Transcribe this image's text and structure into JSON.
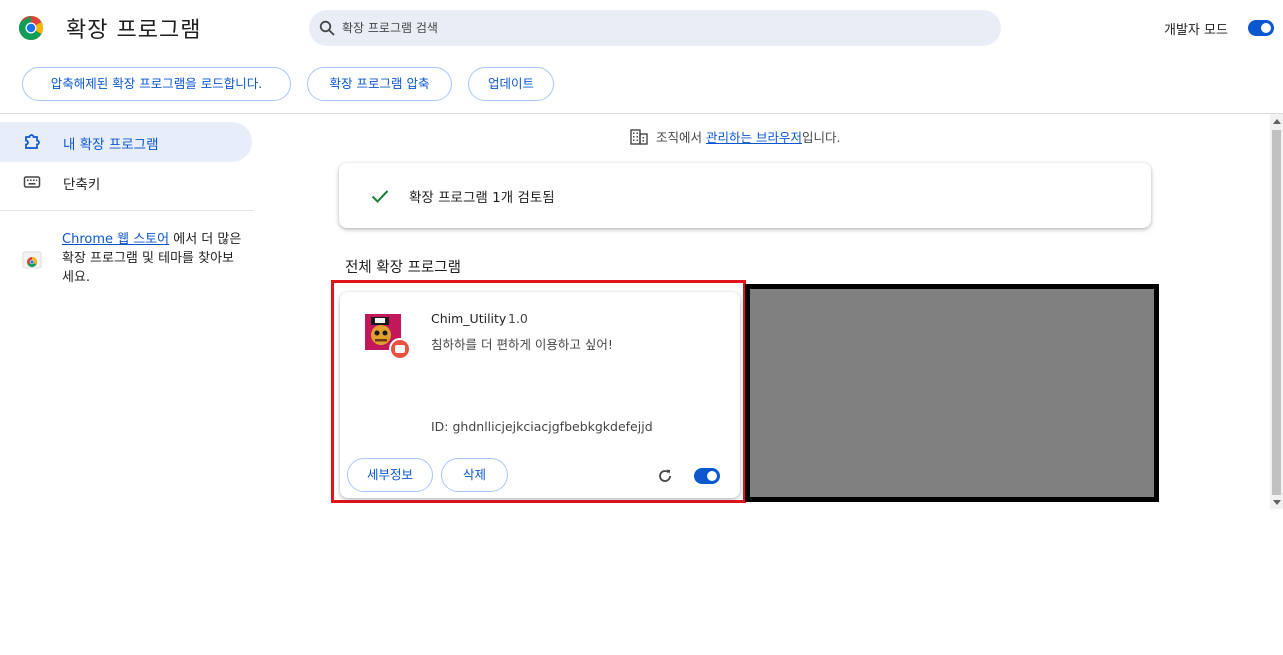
{
  "header": {
    "title": "확장 프로그램",
    "logo_icon": "chrome-logo-icon",
    "search": {
      "placeholder": "확장 프로그램 검색",
      "value": ""
    },
    "dev_mode": {
      "label": "개발자 모드",
      "enabled": true
    }
  },
  "toolbar": {
    "load_unpacked": "압축해제된 확장 프로그램을 로드합니다.",
    "pack_extension": "확장 프로그램 압축",
    "update": "업데이트"
  },
  "sidebar": {
    "items": [
      {
        "label": "내 확장 프로그램",
        "icon": "puzzle-icon",
        "active": true
      },
      {
        "label": "단축키",
        "icon": "keyboard-icon",
        "active": false
      }
    ],
    "store_link": "Chrome 웹 스토어",
    "store_text": "에서 더 많은 확장 프로그램 및 테마를 찾아보세요."
  },
  "main": {
    "managed_prefix": "조직에서 ",
    "managed_link": "관리하는 브라우저",
    "managed_suffix": "입니다.",
    "review_text": "확장 프로그램 1개 검토됨",
    "section_title": "전체 확장 프로그램",
    "extension": {
      "name": "Chim_Utility",
      "version": "1.0",
      "description": "침하하를 더 편하게 이용하고 싶어!",
      "id": "ID: ghdnllicjejkciacjgfbebkgkdefejjd",
      "details_label": "세부정보",
      "remove_label": "삭제",
      "enabled": true
    }
  },
  "colors": {
    "accent": "#0b57d0",
    "highlight_frame": "#e1131c",
    "redacted_block": "#808080"
  }
}
